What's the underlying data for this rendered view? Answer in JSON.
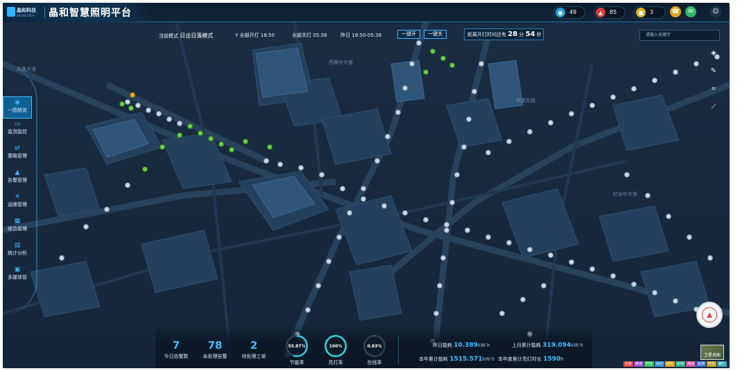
{
  "app": {
    "logo_text": "晶和科技",
    "logo_sub": "JINGHE TECH",
    "title": "晶和智慧照明平台"
  },
  "status_pills": [
    {
      "icon": "location-pin-icon",
      "color": "#1aa3e0",
      "count": "49"
    },
    {
      "icon": "alarm-icon",
      "color": "#d93a3a",
      "count": "85"
    },
    {
      "icon": "workorder-icon",
      "color": "#e0b21a",
      "count": "3"
    }
  ],
  "header_buttons": [
    {
      "icon": "phone-icon",
      "color": "#e0a21a"
    },
    {
      "icon": "message-icon",
      "color": "#2fb86a"
    },
    {
      "icon": "user-avatar-icon",
      "color": "#1e3346"
    }
  ],
  "toolbar": {
    "mode_label": "当前模式",
    "mode_value": "日出日落模式",
    "all_on_label": "全部开灯",
    "all_on_time": "18:50",
    "all_off_label": "全部关灯",
    "all_off_time": "05:38",
    "yesterday_label": "昨日",
    "yesterday_range": "18:50-05:38",
    "one_key_on": "一键开",
    "one_key_off": "一键关",
    "countdown_prefix": "距离开灯时间还有",
    "countdown_h": "28",
    "countdown_h_unit": "分",
    "countdown_m": "54",
    "countdown_m_unit": "秒"
  },
  "search": {
    "placeholder": "请输入关键字"
  },
  "sidebar": {
    "items": [
      {
        "icon": "globe-icon",
        "label": "一图统览",
        "active": true
      },
      {
        "icon": "monitor-icon",
        "label": "监测监控",
        "active": false
      },
      {
        "icon": "strategy-icon",
        "label": "策略管理",
        "active": false
      },
      {
        "icon": "alarm-bell-icon",
        "label": "告警管理",
        "active": false
      },
      {
        "icon": "wrench-icon",
        "label": "运维管理",
        "active": false
      },
      {
        "icon": "grid-icon",
        "label": "综合管理",
        "active": false
      },
      {
        "icon": "chart-icon",
        "label": "统计分析",
        "active": false
      },
      {
        "icon": "media-icon",
        "label": "多媒体管",
        "active": false
      }
    ]
  },
  "right_tools": [
    "layers-icon",
    "pencil-icon",
    "crop-icon",
    "ruler-icon"
  ],
  "map_widgets": {
    "satellite_label": "卫星地图"
  },
  "legend": [
    {
      "label": "告警",
      "color": "#e23c3c"
    },
    {
      "label": "离线",
      "color": "#9a4bd6"
    },
    {
      "label": "开灯",
      "color": "#3ac15a"
    },
    {
      "label": "关灯",
      "color": "#2f8fd8"
    },
    {
      "label": "调光",
      "color": "#e0a21a"
    },
    {
      "label": "在线",
      "color": "#23b38f"
    },
    {
      "label": "离线",
      "color": "#d74f9a"
    },
    {
      "label": "监测",
      "color": "#3b6fe0"
    },
    {
      "label": "开灯",
      "color": "#c2a020"
    },
    {
      "label": "路灯",
      "color": "#2aa7b8"
    }
  ],
  "stats": {
    "alarms_today": {
      "value": "7",
      "label": "今日告警数"
    },
    "unprocessed_alarms": {
      "value": "78",
      "label": "未处理告警"
    },
    "pending_orders": {
      "value": "2",
      "label": "待处理工单"
    }
  },
  "gauges": [
    {
      "value": "55.87",
      "unit": "%",
      "label": "节能率",
      "pct": 55.87,
      "color": "#29c7e6"
    },
    {
      "value": "100",
      "unit": "%",
      "label": "亮灯率",
      "pct": 100,
      "color": "#29d6d6"
    },
    {
      "value": "0.83",
      "unit": "%",
      "label": "在线率",
      "pct": 0.83,
      "color": "#5b7a95"
    }
  ],
  "energy": {
    "yesterday_label": "昨日能耗",
    "yesterday_value": "10.389",
    "yesterday_unit": "kW·h",
    "last_month_label": "上月累计能耗",
    "last_month_value": "319.094",
    "last_month_unit": "kW·h",
    "year_energy_label": "本年累计能耗",
    "year_energy_value": "1515.571",
    "year_energy_unit": "kW·h",
    "year_hours_label": "本年度累计亮灯时长",
    "year_hours_value": "1590",
    "year_hours_unit": "h"
  }
}
